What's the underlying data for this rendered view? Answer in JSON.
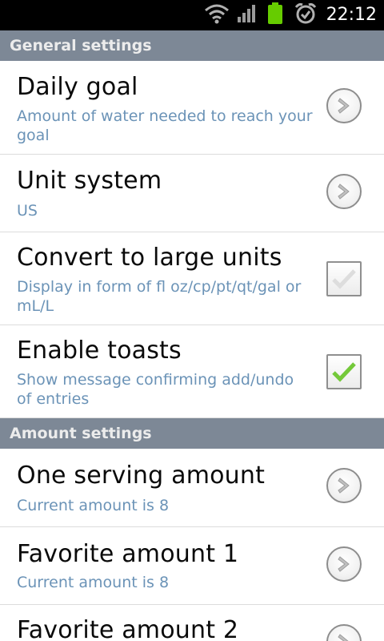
{
  "status_bar": {
    "time": "22:12",
    "icons": [
      "wifi-icon",
      "signal-icon",
      "battery-icon",
      "alarm-icon"
    ],
    "battery_color": "#66cc00"
  },
  "sections": [
    {
      "header": "General settings",
      "items": [
        {
          "title": "Daily goal",
          "summary": "Amount of water needed to reach your goal",
          "widget": "chevron"
        },
        {
          "title": "Unit system",
          "summary": "US",
          "widget": "chevron"
        },
        {
          "title": "Convert to large units",
          "summary": "Display in form of fl oz/cp/pt/qt/gal or mL/L",
          "widget": "checkbox",
          "checked": false
        },
        {
          "title": "Enable toasts",
          "summary": "Show message confirming add/undo of entries",
          "widget": "checkbox",
          "checked": true
        }
      ]
    },
    {
      "header": "Amount settings",
      "items": [
        {
          "title": "One serving amount",
          "summary": "Current amount is 8",
          "widget": "chevron"
        },
        {
          "title": "Favorite amount 1",
          "summary": "Current amount is 8",
          "widget": "chevron"
        },
        {
          "title": "Favorite amount 2",
          "widget": "chevron"
        }
      ]
    }
  ],
  "colors": {
    "section_header_bg": "#7d8896",
    "summary_text": "#6b93b7",
    "check_green": "#74c93a"
  }
}
